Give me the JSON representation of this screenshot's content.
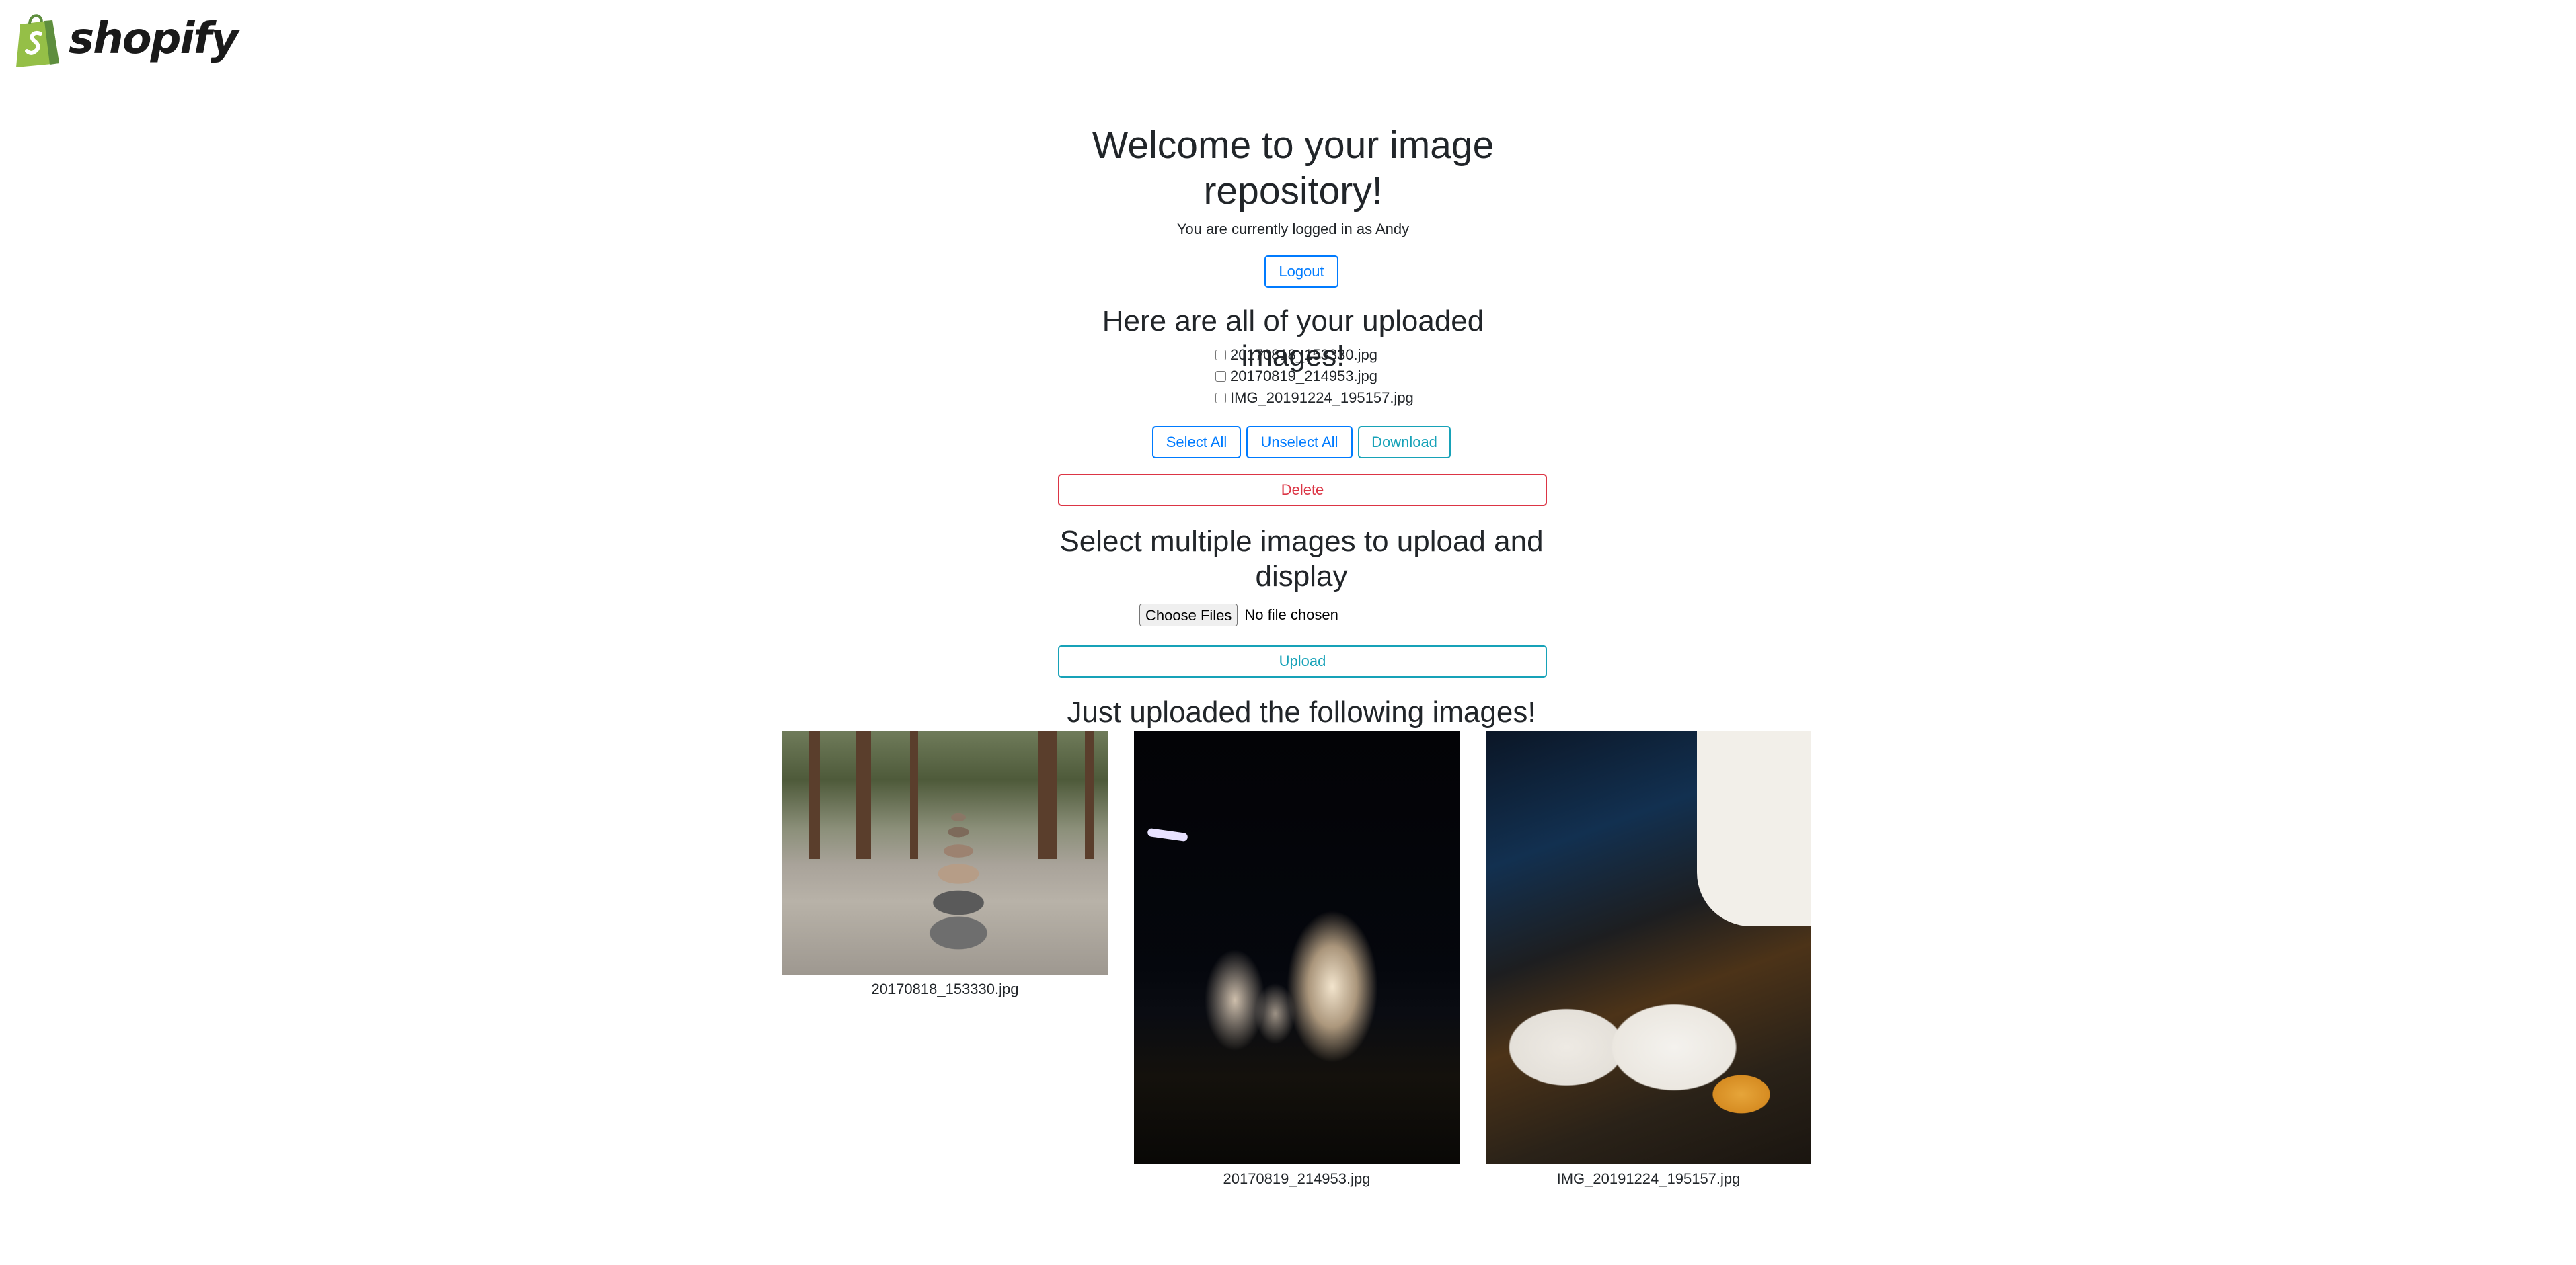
{
  "brand": {
    "name": "shopify"
  },
  "header": {
    "title": "Welcome to your image repository!",
    "login_status": "You are currently logged in as Andy",
    "logout_label": "Logout"
  },
  "uploaded": {
    "heading": "Here are all of your uploaded images!",
    "files": [
      "20170818_153330.jpg",
      "20170819_214953.jpg",
      "IMG_20191224_195157.jpg"
    ],
    "select_all_label": "Select All",
    "unselect_all_label": "Unselect All",
    "download_label": "Download",
    "delete_label": "Delete"
  },
  "upload": {
    "heading": "Select multiple images to upload and display",
    "choose_files_label": "Choose Files",
    "no_file_text": "No file chosen",
    "upload_label": "Upload"
  },
  "recent": {
    "heading": "Just uploaded the following images!",
    "images": [
      {
        "caption": "20170818_153330.jpg"
      },
      {
        "caption": "20170819_214953.jpg"
      },
      {
        "caption": "IMG_20191224_195157.jpg"
      }
    ]
  },
  "colors": {
    "primary": "#007bff",
    "info": "#17a2b8",
    "danger": "#dc3545",
    "shopify_green": "#95bf47"
  }
}
